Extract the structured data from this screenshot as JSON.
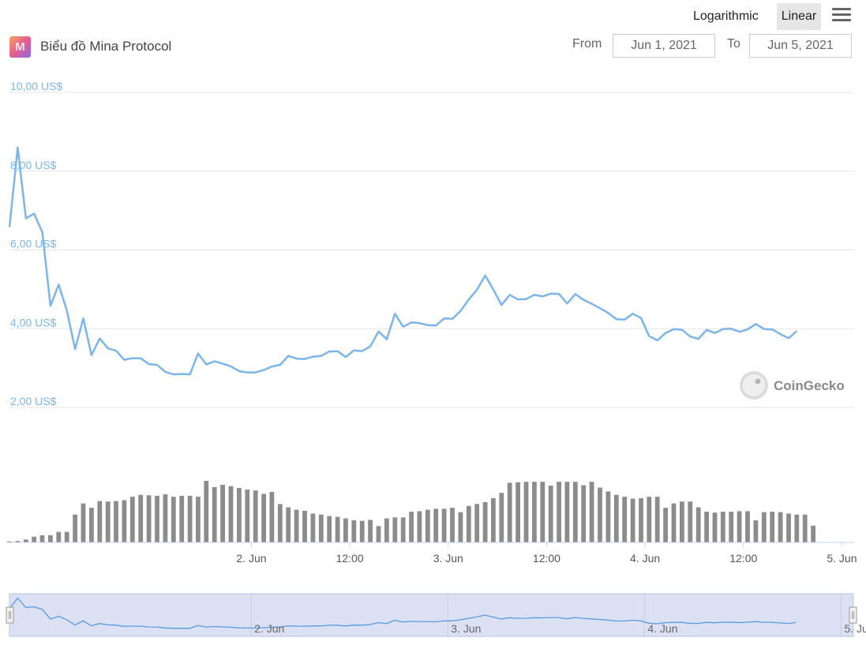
{
  "toolbar": {
    "logarithmic_label": "Logarithmic",
    "linear_label": "Linear",
    "selected_scale": "Linear",
    "menu_icon": "hamburger-menu-icon"
  },
  "header": {
    "title": "Biểu đồ Mina Protocol",
    "logo_icon": "mina-protocol-logo-icon"
  },
  "range": {
    "from_label": "From",
    "from_value": "Jun 1, 2021",
    "to_label": "To",
    "to_value": "Jun 5, 2021"
  },
  "credit": {
    "text": "CoinGecko",
    "icon": "coingecko-gecko-icon"
  },
  "colors": {
    "price_line": "#7cb5ec",
    "volume_bar": "#8c8c8c",
    "navigator_fill": "#dbe1f3",
    "navigator_line": "#5b9be0",
    "grid": "#e6e6e6"
  },
  "chart_data": {
    "type": "line",
    "title": "Biểu đồ Mina Protocol",
    "ylim": [
      2,
      10
    ],
    "yticks": [
      "10,00 US$",
      "8,00 US$",
      "6,00 US$",
      "4,00 US$",
      "2,00 US$"
    ],
    "ytick_values": [
      10,
      8,
      6,
      4,
      2
    ],
    "xlim": [
      0.7708,
      5.0625
    ],
    "xticks": [
      {
        "label": "2. Jun",
        "value": 2.0
      },
      {
        "label": "12:00",
        "value": 2.5
      },
      {
        "label": "3. Jun",
        "value": 3.0
      },
      {
        "label": "12:00",
        "value": 3.5
      },
      {
        "label": "4. Jun",
        "value": 4.0
      },
      {
        "label": "12:00",
        "value": 4.5
      },
      {
        "label": "5. Jun",
        "value": 5.0
      }
    ],
    "navigator_ticks": [
      {
        "label": "2. Jun",
        "value": 2.0
      },
      {
        "label": "3. Jun",
        "value": 3.0
      },
      {
        "label": "4. Jun",
        "value": 4.0
      },
      {
        "label": "5. Jun",
        "value": 5.0
      }
    ],
    "grid": true,
    "series": [
      {
        "type": "line",
        "x_start": 0.7708,
        "x_step": 0.04167,
        "values": [
          6.58,
          8.6,
          6.8,
          6.92,
          6.45,
          4.58,
          5.12,
          4.46,
          3.48,
          4.26,
          3.33,
          3.75,
          3.5,
          3.44,
          3.21,
          3.25,
          3.25,
          3.1,
          3.08,
          2.9,
          2.84,
          2.85,
          2.84,
          3.37,
          3.09,
          3.17,
          3.11,
          3.04,
          2.92,
          2.89,
          2.89,
          2.95,
          3.04,
          3.08,
          3.31,
          3.24,
          3.23,
          3.29,
          3.31,
          3.42,
          3.43,
          3.28,
          3.45,
          3.43,
          3.55,
          3.93,
          3.73,
          4.38,
          4.05,
          4.16,
          4.14,
          4.09,
          4.08,
          4.26,
          4.25,
          4.45,
          4.74,
          4.99,
          5.35,
          4.99,
          4.6,
          4.86,
          4.74,
          4.75,
          4.86,
          4.82,
          4.89,
          4.88,
          4.64,
          4.88,
          4.73,
          4.63,
          4.52,
          4.4,
          4.24,
          4.23,
          4.38,
          4.27,
          3.81,
          3.7,
          3.89,
          3.99,
          3.97,
          3.8,
          3.74,
          3.97,
          3.89,
          3.99,
          4.0,
          3.92,
          3.98,
          4.12,
          3.99,
          3.98,
          3.86,
          3.76,
          3.94
        ]
      },
      {
        "type": "bar",
        "x_start": 0.7708,
        "x_step": 0.04167,
        "values": [
          0.02,
          0.03,
          0.06,
          0.12,
          0.15,
          0.15,
          0.22,
          0.22,
          0.58,
          0.81,
          0.72,
          0.86,
          0.85,
          0.86,
          0.88,
          0.95,
          0.99,
          0.98,
          0.97,
          1.0,
          0.95,
          0.97,
          0.97,
          0.95,
          1.28,
          1.15,
          1.2,
          1.17,
          1.13,
          1.1,
          1.08,
          1.01,
          1.05,
          0.8,
          0.73,
          0.68,
          0.66,
          0.6,
          0.58,
          0.55,
          0.53,
          0.5,
          0.46,
          0.45,
          0.47,
          0.34,
          0.5,
          0.52,
          0.52,
          0.64,
          0.65,
          0.68,
          0.7,
          0.7,
          0.72,
          0.63,
          0.76,
          0.8,
          0.84,
          0.92,
          1.03,
          1.24,
          1.25,
          1.26,
          1.26,
          1.26,
          1.18,
          1.26,
          1.26,
          1.26,
          1.19,
          1.26,
          1.14,
          1.06,
          0.99,
          0.95,
          0.91,
          0.92,
          0.95,
          0.95,
          0.72,
          0.81,
          0.85,
          0.85,
          0.73,
          0.64,
          0.62,
          0.64,
          0.64,
          0.65,
          0.65,
          0.46,
          0.63,
          0.64,
          0.63,
          0.6,
          0.58,
          0.58,
          0.35
        ]
      }
    ]
  }
}
